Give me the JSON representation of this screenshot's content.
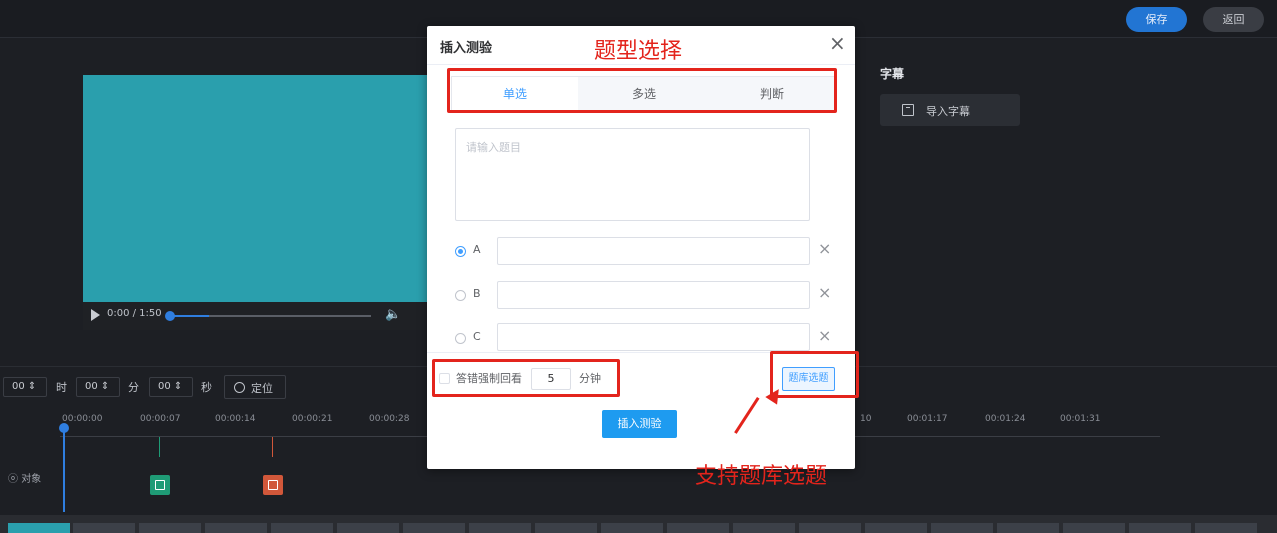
{
  "topbar": {
    "save_label": "保存",
    "back_label": "返回"
  },
  "video": {
    "time": "0:00 / 1:50"
  },
  "subtitles": {
    "title": "字幕",
    "import_label": "导入字幕"
  },
  "time_locator": {
    "hour": "00",
    "hour_unit": "时",
    "minute": "00",
    "minute_unit": "分",
    "second": "00",
    "second_unit": "秒",
    "locate_label": "定位"
  },
  "timeline": {
    "ticks_left": [
      "00:00:00",
      "00:00:07",
      "00:00:14",
      "00:00:21",
      "00:00:28"
    ],
    "tick_partial": "10",
    "ticks_right": [
      "00:01:17",
      "00:01:24",
      "00:01:31"
    ],
    "object_track_label": "对象"
  },
  "modal": {
    "title": "插入测验",
    "close": "×",
    "tabs": [
      "单选",
      "多选",
      "判断"
    ],
    "active_tab": "单选",
    "question_placeholder": "请输入题目",
    "options": [
      {
        "letter": "A",
        "checked": true
      },
      {
        "letter": "B",
        "checked": false
      },
      {
        "letter": "C",
        "checked": false
      }
    ],
    "delete_glyph": "×",
    "force_review_label": "答错强制回看",
    "force_review_minutes": "5",
    "minutes_unit": "分钟",
    "bank_button": "题库选题",
    "insert_button": "插入测验"
  },
  "annotations": {
    "type_select": "题型选择",
    "bank_support": "支持题库选题"
  },
  "colors": {
    "accent": "#409eff",
    "annotation": "#e3241c",
    "video": "#2a9fad"
  }
}
